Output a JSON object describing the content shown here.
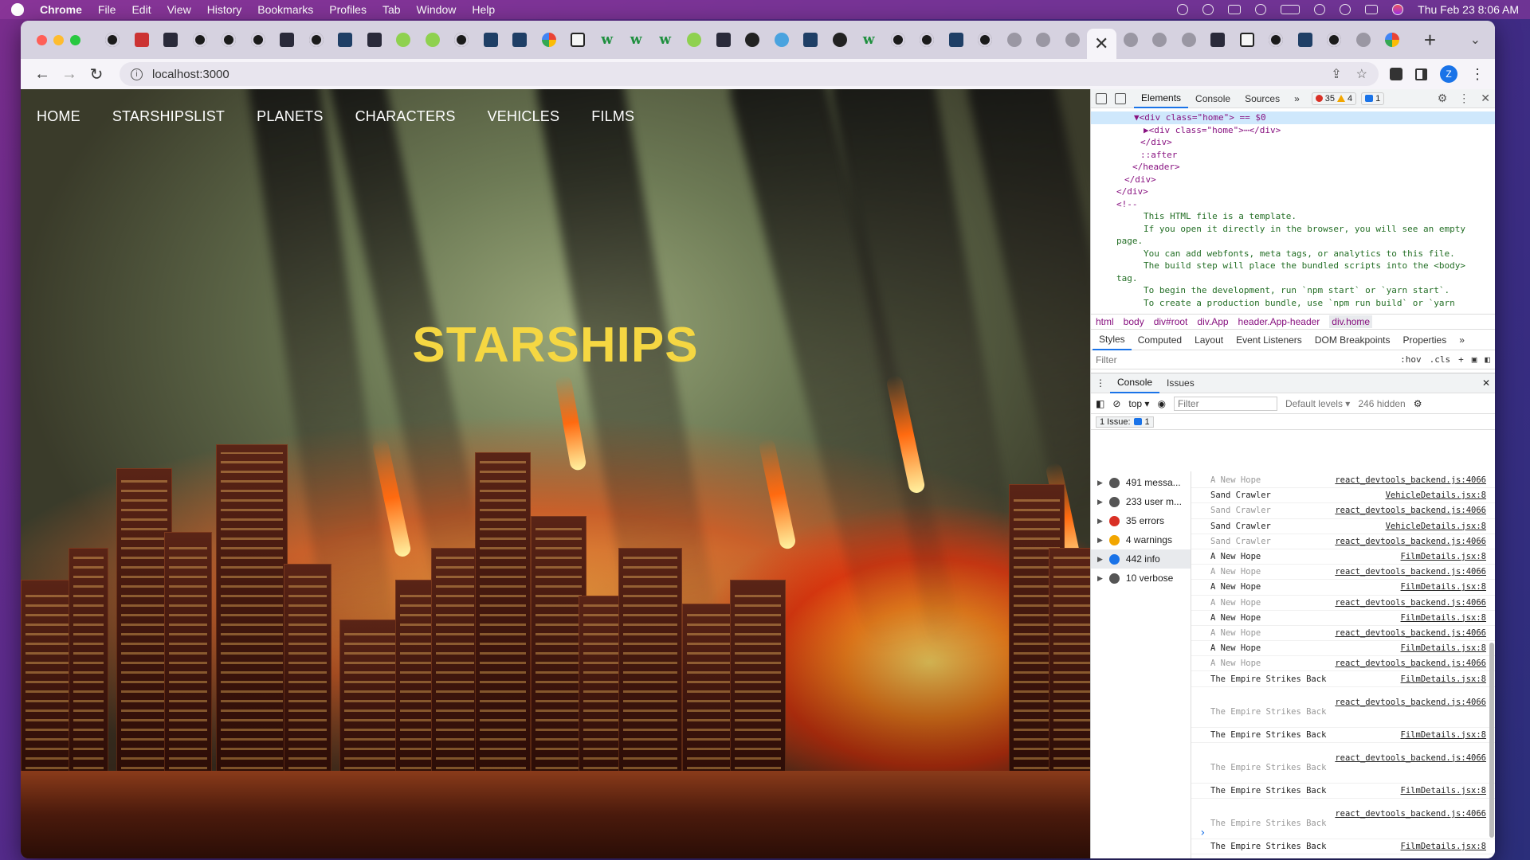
{
  "menubar": {
    "app": "Chrome",
    "items": [
      "File",
      "Edit",
      "View",
      "History",
      "Bookmarks",
      "Profiles",
      "Tab",
      "Window",
      "Help"
    ],
    "datetime": "Thu Feb 23  8:06 AM"
  },
  "browser": {
    "url": "localhost:3000",
    "avatar_letter": "Z"
  },
  "site": {
    "nav": [
      "HOME",
      "STARSHIPSLIST",
      "PLANETS",
      "CHARACTERS",
      "VEHICLES",
      "FILMS"
    ],
    "hero_title": "STARSHIPS"
  },
  "devtools": {
    "tabs": [
      "Elements",
      "Console",
      "Sources"
    ],
    "badges": {
      "errors": "35",
      "warnings": "4",
      "info": "1"
    },
    "elements_lines": [
      {
        "code": "▼<div class=\"home\"> == $0",
        "sel": true,
        "indent": 54
      },
      {
        "code": "▶<div class=\"home\">⋯</div>",
        "indent": 66
      },
      {
        "code": "</div>",
        "indent": 62
      },
      {
        "code": "::after",
        "indent": 62
      },
      {
        "code": "</header>",
        "indent": 52
      },
      {
        "code": "</div>",
        "indent": 42
      },
      {
        "code": "</div>",
        "indent": 32
      },
      {
        "code": "<!--",
        "indent": 32
      },
      {
        "code": "This HTML file is a template.",
        "indent": 66,
        "cmt": true
      },
      {
        "code": "If you open it directly in the browser, you will see an empty",
        "indent": 66,
        "cmt": true
      },
      {
        "code": "page.",
        "indent": 32,
        "cmt": true
      },
      {
        "code": "",
        "indent": 32
      },
      {
        "code": "You can add webfonts, meta tags, or analytics to this file.",
        "indent": 66,
        "cmt": true
      },
      {
        "code": "The build step will place the bundled scripts into the <body>",
        "indent": 66,
        "cmt": true
      },
      {
        "code": "tag.",
        "indent": 32,
        "cmt": true
      },
      {
        "code": "",
        "indent": 32
      },
      {
        "code": "To begin the development, run `npm start` or `yarn start`.",
        "indent": 66,
        "cmt": true
      },
      {
        "code": "To create a production bundle, use `npm run build` or `yarn",
        "indent": 66,
        "cmt": true
      }
    ],
    "breadcrumb": [
      "html",
      "body",
      "div#root",
      "div.App",
      "header.App-header",
      "div.home"
    ],
    "styles_tabs": [
      "Styles",
      "Computed",
      "Layout",
      "Event Listeners",
      "DOM Breakpoints",
      "Properties"
    ],
    "filter_placeholder": "Filter",
    "hov": ":hov",
    "cls": ".cls",
    "drawer_tabs": [
      "Console",
      "Issues"
    ],
    "console": {
      "context": "top ▾",
      "filter_placeholder": "Filter",
      "levels": "Default levels ▾",
      "hidden": "246 hidden",
      "issues": "1 Issue:",
      "issues_count": "1"
    },
    "sidebar": [
      {
        "label": "491 messa...",
        "ico": "list"
      },
      {
        "label": "233 user m...",
        "ico": "user"
      },
      {
        "label": "35 errors",
        "ico": "error"
      },
      {
        "label": "4 warnings",
        "ico": "warn"
      },
      {
        "label": "442 info",
        "ico": "info"
      },
      {
        "label": "10 verbose",
        "ico": "bug"
      }
    ],
    "messages": [
      {
        "text": "A New Hope",
        "src": "react_devtools_backend.js:4066",
        "dim": true
      },
      {
        "text": "Sand Crawler",
        "src": "VehicleDetails.jsx:8"
      },
      {
        "text": "Sand Crawler",
        "src": "react_devtools_backend.js:4066",
        "dim": true
      },
      {
        "text": "Sand Crawler",
        "src": "VehicleDetails.jsx:8"
      },
      {
        "text": "Sand Crawler",
        "src": "react_devtools_backend.js:4066",
        "dim": true
      },
      {
        "text": "A New Hope",
        "src": "FilmDetails.jsx:8"
      },
      {
        "text": "A New Hope",
        "src": "react_devtools_backend.js:4066",
        "dim": true
      },
      {
        "text": "A New Hope",
        "src": "FilmDetails.jsx:8"
      },
      {
        "text": "A New Hope",
        "src": "react_devtools_backend.js:4066",
        "dim": true
      },
      {
        "text": "A New Hope",
        "src": "FilmDetails.jsx:8"
      },
      {
        "text": "A New Hope",
        "src": "react_devtools_backend.js:4066",
        "dim": true
      },
      {
        "text": "A New Hope",
        "src": "FilmDetails.jsx:8"
      },
      {
        "text": "A New Hope",
        "src": "react_devtools_backend.js:4066",
        "dim": true
      },
      {
        "text": "The Empire Strikes Back",
        "src": "FilmDetails.jsx:8"
      },
      {
        "text": "The Empire Strikes Back",
        "src": "react_devtools_backend.js:4066",
        "dim": true,
        "two": true
      },
      {
        "text": "The Empire Strikes Back",
        "src": "FilmDetails.jsx:8"
      },
      {
        "text": "The Empire Strikes Back",
        "src": "react_devtools_backend.js:4066",
        "dim": true,
        "two": true
      },
      {
        "text": "The Empire Strikes Back",
        "src": "FilmDetails.jsx:8"
      },
      {
        "text": "The Empire Strikes Back",
        "src": "react_devtools_backend.js:4066",
        "dim": true,
        "two": true
      },
      {
        "text": "The Empire Strikes Back",
        "src": "FilmDetails.jsx:8"
      },
      {
        "text": "The Empire Strikes Back",
        "src": "react_devtools_backend.js:4066",
        "dim": true,
        "two": true
      }
    ]
  }
}
